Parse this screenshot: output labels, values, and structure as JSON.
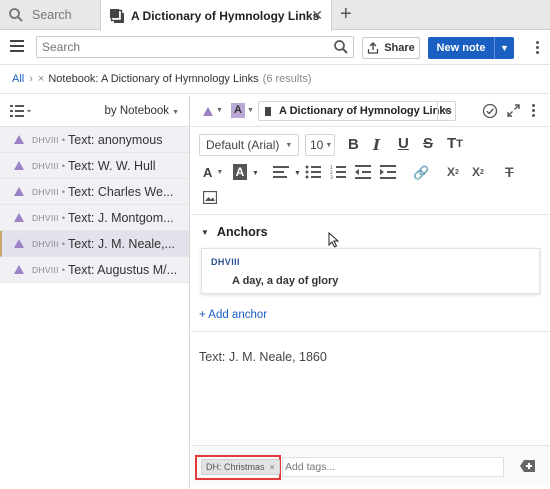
{
  "tabs": [
    {
      "label": "Search",
      "icon": "search-icon",
      "active": false
    },
    {
      "label": "A Dictionary of Hymnology Links",
      "icon": "notebook-stack-icon",
      "active": true
    }
  ],
  "toolbar": {
    "search_placeholder": "Search",
    "share_label": "Share",
    "new_note_label": "New note"
  },
  "breadcrumb": {
    "root": "All",
    "filter": "Notebook: A Dictionary of Hymnology Links",
    "count": "(6 results)"
  },
  "notes_list": {
    "sort_label": "by Notebook",
    "items": [
      {
        "code": "DHVIII",
        "title": "Text: anonymous",
        "selected": false
      },
      {
        "code": "DHVIII",
        "title": "Text: W. W. Hull",
        "selected": false
      },
      {
        "code": "DHVIII",
        "title": "Text: Charles We...",
        "selected": false
      },
      {
        "code": "DHVIII",
        "title": "Text: J. Montgom...",
        "selected": false
      },
      {
        "code": "DHVIII",
        "title": "Text: J. M. Neale,...",
        "selected": true
      },
      {
        "code": "DHVIII",
        "title": "Text: Augustus M/...",
        "selected": false
      }
    ]
  },
  "editor": {
    "notebook": "A Dictionary of Hymnology Links",
    "font_family": "Default (Arial)",
    "font_size": "10",
    "anchors_heading": "Anchors",
    "anchor": {
      "code": "DHVIII",
      "text": "A day, a day of glory"
    },
    "add_anchor_label": "+ Add anchor",
    "body": "Text: J. M. Neale, 1860"
  },
  "tags": {
    "items": [
      "DH: Christmas"
    ],
    "placeholder": "Add tags..."
  },
  "colors": {
    "accent_blue": "#1a5fc1",
    "shape_purple": "#9b82c5",
    "highlight_red": "#e23a3a"
  }
}
